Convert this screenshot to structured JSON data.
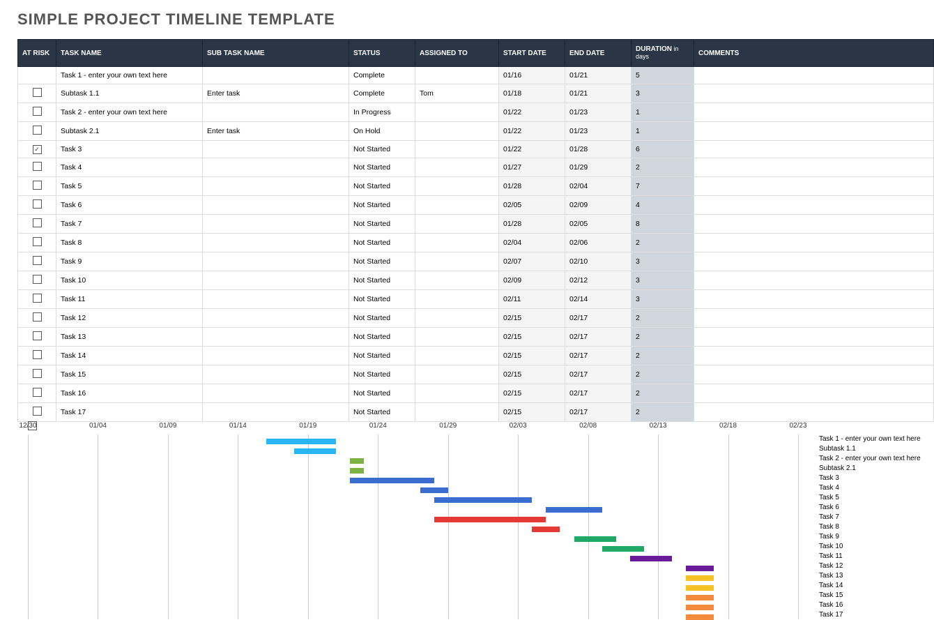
{
  "title": "SIMPLE PROJECT TIMELINE TEMPLATE",
  "columns": {
    "at_risk": "AT RISK",
    "task_name": "TASK NAME",
    "sub_task_name": "SUB TASK NAME",
    "status": "STATUS",
    "assigned_to": "ASSIGNED TO",
    "start_date": "START DATE",
    "end_date": "END DATE",
    "duration": "DURATION",
    "duration_sub": " in days",
    "comments": "COMMENTS"
  },
  "rows": [
    {
      "at_risk": null,
      "task": "Task 1 - enter your own text here",
      "subtask": "",
      "status": "Complete",
      "assigned": "",
      "start": "01/16",
      "end": "01/21",
      "duration": "5",
      "comments": ""
    },
    {
      "at_risk": false,
      "task": "Subtask 1.1",
      "subtask": "Enter task",
      "status": "Complete",
      "assigned": "Tom",
      "start": "01/18",
      "end": "01/21",
      "duration": "3",
      "comments": ""
    },
    {
      "at_risk": false,
      "task": "Task 2 - enter your own text here",
      "subtask": "",
      "status": "In Progress",
      "assigned": "",
      "start": "01/22",
      "end": "01/23",
      "duration": "1",
      "comments": ""
    },
    {
      "at_risk": false,
      "task": "Subtask 2.1",
      "subtask": "Enter task",
      "status": "On Hold",
      "assigned": "",
      "start": "01/22",
      "end": "01/23",
      "duration": "1",
      "comments": ""
    },
    {
      "at_risk": true,
      "task": "Task 3",
      "subtask": "",
      "status": "Not Started",
      "assigned": "",
      "start": "01/22",
      "end": "01/28",
      "duration": "6",
      "comments": ""
    },
    {
      "at_risk": false,
      "task": "Task 4",
      "subtask": "",
      "status": "Not Started",
      "assigned": "",
      "start": "01/27",
      "end": "01/29",
      "duration": "2",
      "comments": ""
    },
    {
      "at_risk": false,
      "task": "Task 5",
      "subtask": "",
      "status": "Not Started",
      "assigned": "",
      "start": "01/28",
      "end": "02/04",
      "duration": "7",
      "comments": ""
    },
    {
      "at_risk": false,
      "task": "Task 6",
      "subtask": "",
      "status": "Not Started",
      "assigned": "",
      "start": "02/05",
      "end": "02/09",
      "duration": "4",
      "comments": ""
    },
    {
      "at_risk": false,
      "task": "Task 7",
      "subtask": "",
      "status": "Not Started",
      "assigned": "",
      "start": "01/28",
      "end": "02/05",
      "duration": "8",
      "comments": ""
    },
    {
      "at_risk": false,
      "task": "Task 8",
      "subtask": "",
      "status": "Not Started",
      "assigned": "",
      "start": "02/04",
      "end": "02/06",
      "duration": "2",
      "comments": ""
    },
    {
      "at_risk": false,
      "task": "Task 9",
      "subtask": "",
      "status": "Not Started",
      "assigned": "",
      "start": "02/07",
      "end": "02/10",
      "duration": "3",
      "comments": ""
    },
    {
      "at_risk": false,
      "task": "Task 10",
      "subtask": "",
      "status": "Not Started",
      "assigned": "",
      "start": "02/09",
      "end": "02/12",
      "duration": "3",
      "comments": ""
    },
    {
      "at_risk": false,
      "task": "Task 11",
      "subtask": "",
      "status": "Not Started",
      "assigned": "",
      "start": "02/11",
      "end": "02/14",
      "duration": "3",
      "comments": ""
    },
    {
      "at_risk": false,
      "task": "Task 12",
      "subtask": "",
      "status": "Not Started",
      "assigned": "",
      "start": "02/15",
      "end": "02/17",
      "duration": "2",
      "comments": ""
    },
    {
      "at_risk": false,
      "task": "Task 13",
      "subtask": "",
      "status": "Not Started",
      "assigned": "",
      "start": "02/15",
      "end": "02/17",
      "duration": "2",
      "comments": ""
    },
    {
      "at_risk": false,
      "task": "Task 14",
      "subtask": "",
      "status": "Not Started",
      "assigned": "",
      "start": "02/15",
      "end": "02/17",
      "duration": "2",
      "comments": ""
    },
    {
      "at_risk": false,
      "task": "Task 15",
      "subtask": "",
      "status": "Not Started",
      "assigned": "",
      "start": "02/15",
      "end": "02/17",
      "duration": "2",
      "comments": ""
    },
    {
      "at_risk": false,
      "task": "Task 16",
      "subtask": "",
      "status": "Not Started",
      "assigned": "",
      "start": "02/15",
      "end": "02/17",
      "duration": "2",
      "comments": ""
    },
    {
      "at_risk": false,
      "task": "Task 17",
      "subtask": "",
      "status": "Not Started",
      "assigned": "",
      "start": "02/15",
      "end": "02/17",
      "duration": "2",
      "comments": ""
    }
  ],
  "chart_data": {
    "type": "bar",
    "orientation": "horizontal-timeline",
    "x_ticks": [
      "12/30",
      "01/04",
      "01/09",
      "01/14",
      "01/19",
      "01/24",
      "01/29",
      "02/03",
      "02/08",
      "02/13",
      "02/18",
      "02/23"
    ],
    "base_date": "12/30",
    "unit": "days",
    "series": [
      {
        "name": "Task 1 - enter your own text here",
        "start": "01/16",
        "end": "01/21",
        "color": "#29b6f6"
      },
      {
        "name": "Subtask 1.1",
        "start": "01/18",
        "end": "01/21",
        "color": "#29b6f6"
      },
      {
        "name": "Task 2 - enter your own text here",
        "start": "01/22",
        "end": "01/23",
        "color": "#7cb342"
      },
      {
        "name": "Subtask 2.1",
        "start": "01/22",
        "end": "01/23",
        "color": "#7cb342"
      },
      {
        "name": "Task 3",
        "start": "01/22",
        "end": "01/28",
        "color": "#3b6dd1"
      },
      {
        "name": "Task 4",
        "start": "01/27",
        "end": "01/29",
        "color": "#3b6dd1"
      },
      {
        "name": "Task 5",
        "start": "01/28",
        "end": "02/04",
        "color": "#3b6dd1"
      },
      {
        "name": "Task 6",
        "start": "02/05",
        "end": "02/09",
        "color": "#3b6dd1"
      },
      {
        "name": "Task 7",
        "start": "01/28",
        "end": "02/05",
        "color": "#e53935"
      },
      {
        "name": "Task 8",
        "start": "02/04",
        "end": "02/06",
        "color": "#e53935"
      },
      {
        "name": "Task 9",
        "start": "02/07",
        "end": "02/10",
        "color": "#1fa866"
      },
      {
        "name": "Task 10",
        "start": "02/09",
        "end": "02/12",
        "color": "#1fa866"
      },
      {
        "name": "Task 11",
        "start": "02/11",
        "end": "02/14",
        "color": "#6a1b9a"
      },
      {
        "name": "Task 12",
        "start": "02/15",
        "end": "02/17",
        "color": "#6a1b9a"
      },
      {
        "name": "Task 13",
        "start": "02/15",
        "end": "02/17",
        "color": "#f9c224"
      },
      {
        "name": "Task 14",
        "start": "02/15",
        "end": "02/17",
        "color": "#f9c224"
      },
      {
        "name": "Task 15",
        "start": "02/15",
        "end": "02/17",
        "color": "#f58a3c"
      },
      {
        "name": "Task 16",
        "start": "02/15",
        "end": "02/17",
        "color": "#f58a3c"
      },
      {
        "name": "Task 17",
        "start": "02/15",
        "end": "02/17",
        "color": "#f58a3c"
      }
    ]
  }
}
